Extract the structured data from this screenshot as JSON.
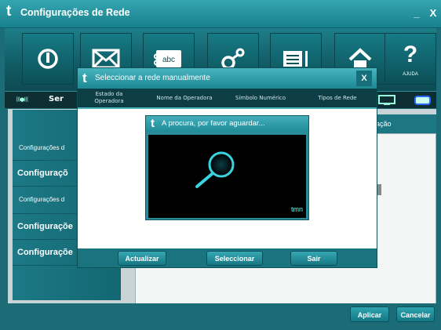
{
  "window": {
    "logo": "t",
    "title": "Configurações de Rede",
    "minimize": "_",
    "close": "X"
  },
  "toolbar": {
    "buttons": [
      {
        "icon": "power-icon"
      },
      {
        "icon": "envelope-icon"
      },
      {
        "icon": "sms-abc-icon",
        "text": "abc"
      },
      {
        "icon": "connection-icon"
      },
      {
        "icon": "phonebook-icon"
      },
      {
        "icon": "home-icon"
      },
      {
        "icon": "help-icon",
        "label": "AJUDA"
      }
    ]
  },
  "status": {
    "signal": ")))●(((",
    "service_text": "Ser"
  },
  "nav": {
    "items": [
      {
        "label": "Configurações d"
      },
      {
        "label": "Configuraçõ"
      },
      {
        "label": "Configurações d"
      },
      {
        "label": "Configuraçõe"
      },
      {
        "label": "Configuraçõe"
      }
    ]
  },
  "panel": {
    "tab_label": "guração"
  },
  "buttons": {
    "apply": "Aplicar",
    "cancel": "Cancelar"
  },
  "dialog": {
    "logo": "t",
    "title": "Seleccionar a rede manualmente",
    "close": "X",
    "columns": [
      {
        "label": "Estado da Operadora"
      },
      {
        "label": "Nome da Operadora"
      },
      {
        "label": "Símbolo Numérico"
      },
      {
        "label": "Tipos de Rede"
      }
    ],
    "buttons": {
      "refresh": "Actualizar",
      "select": "Seleccionar",
      "exit": "Sair"
    }
  },
  "search_popup": {
    "logo": "t",
    "message": "A procura, por favor aguardar...",
    "brand": "tmn"
  },
  "colors": {
    "accent": "#1b8995",
    "dark": "#0d3e45",
    "glow": "#3ad4e0"
  }
}
